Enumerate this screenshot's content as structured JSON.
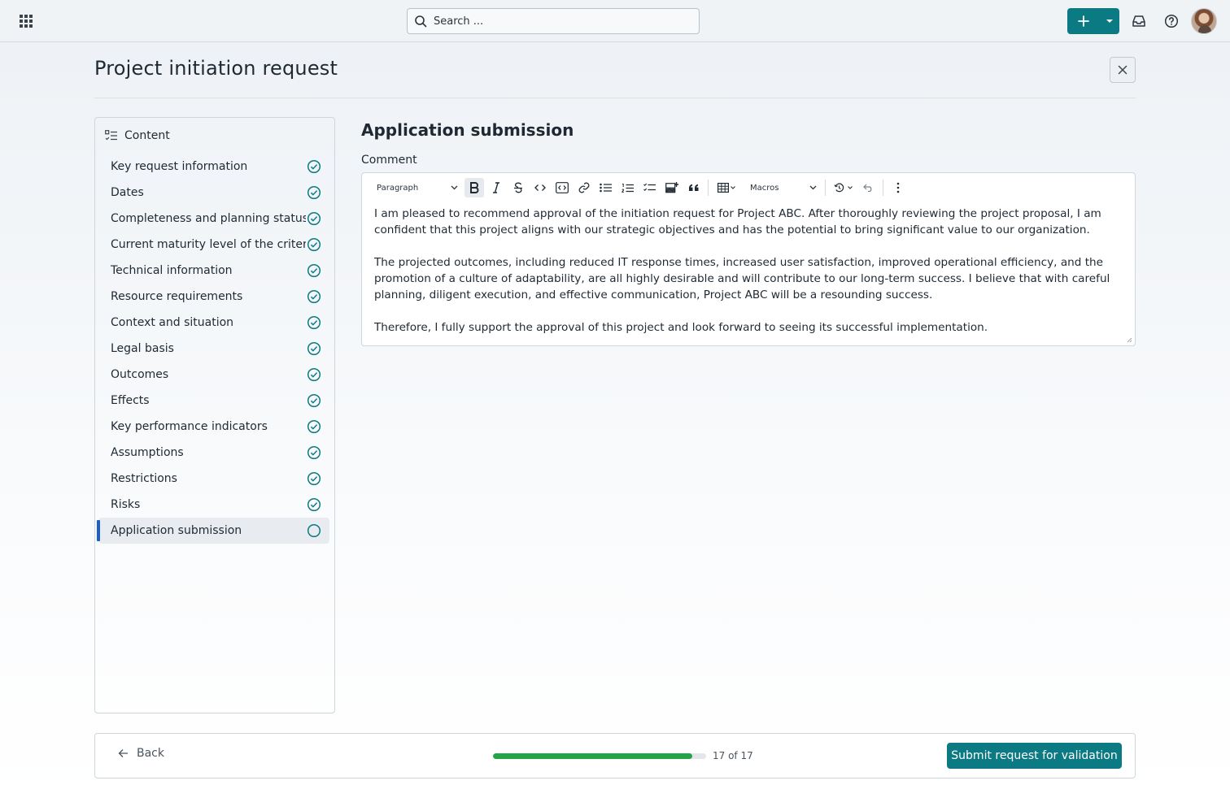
{
  "topbar": {
    "search_placeholder": "Search ...",
    "icons": [
      "apps-grid-icon",
      "search-icon",
      "plus-icon",
      "chevron-down-icon",
      "inbox-icon",
      "help-icon",
      "avatar"
    ]
  },
  "header": {
    "title": "Project initiation request"
  },
  "sidebar": {
    "heading": "Content",
    "items": [
      {
        "label": "Key request information",
        "status": "complete"
      },
      {
        "label": "Dates",
        "status": "complete"
      },
      {
        "label": "Completeness and planning status",
        "status": "complete"
      },
      {
        "label": "Current maturity level of the criteria",
        "status": "complete"
      },
      {
        "label": "Technical information",
        "status": "complete"
      },
      {
        "label": "Resource requirements",
        "status": "complete"
      },
      {
        "label": "Context and situation",
        "status": "complete"
      },
      {
        "label": "Legal basis",
        "status": "complete"
      },
      {
        "label": "Outcomes",
        "status": "complete"
      },
      {
        "label": "Effects",
        "status": "complete"
      },
      {
        "label": "Key performance indicators",
        "status": "complete"
      },
      {
        "label": "Assumptions",
        "status": "complete"
      },
      {
        "label": "Restrictions",
        "status": "complete"
      },
      {
        "label": "Risks",
        "status": "complete"
      },
      {
        "label": "Application submission",
        "status": "current"
      }
    ]
  },
  "main": {
    "section_title": "Application submission",
    "comment_label": "Comment",
    "toolbar": {
      "block_format": "Paragraph",
      "macros": "Macros"
    },
    "paragraphs": [
      "I am pleased to recommend approval of the initiation request for Project ABC. After thoroughly reviewing the project proposal, I am confident that this project aligns with our strategic objectives and has the potential to bring significant value to our organization.",
      "The projected outcomes, including reduced IT response times, increased user satisfaction, improved operational efficiency, and the promotion of a culture of adaptability, are all highly desirable and will contribute to our long-term success. I believe that with careful planning, diligent execution, and effective communication, Project ABC will be a resounding success.",
      "Therefore, I fully support the approval of this project and look forward to seeing its successful implementation."
    ]
  },
  "footer": {
    "back_label": "Back",
    "progress_fraction": 0.935,
    "progress_text": "17 of 17",
    "submit_label": "Submit request for validation"
  },
  "colors": {
    "accent": "#0b7a83",
    "check": "#0b7a83",
    "progress": "#22a447",
    "active_marker": "#1d5fc9"
  }
}
